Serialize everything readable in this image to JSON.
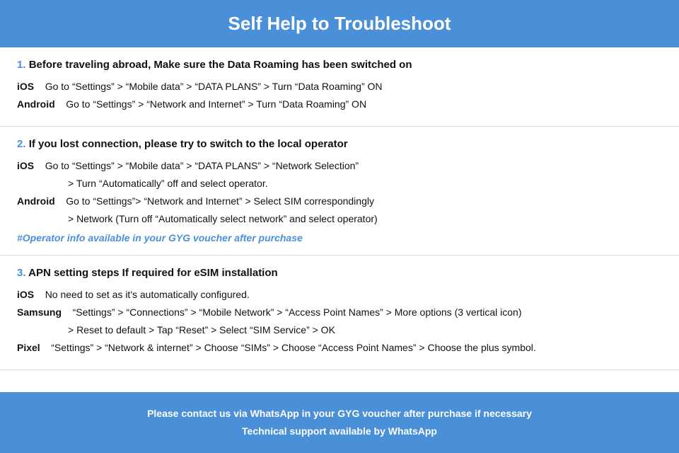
{
  "header": {
    "title": "Self Help to Troubleshoot"
  },
  "sections": [
    {
      "id": "section-1",
      "number": "1.",
      "title": "Before traveling abroad, Make sure the Data Roaming has been switched on",
      "items": [
        {
          "platform": "iOS",
          "text": "Go to “Settings” > “Mobile data” > “DATA PLANS” > Turn “Data Roaming” ON",
          "continuation": null
        },
        {
          "platform": "Android",
          "text": "Go to “Settings” > “Network and Internet” > Turn “Data Roaming” ON",
          "continuation": null
        }
      ],
      "link": null
    },
    {
      "id": "section-2",
      "number": "2.",
      "title": "If you lost connection, please try to switch to the local operator",
      "items": [
        {
          "platform": "iOS",
          "text": "Go to “Settings” > “Mobile data” > “DATA PLANS” > “Network Selection”",
          "continuation": "> Turn “Automatically” off and select operator."
        },
        {
          "platform": "Android",
          "text": "Go to “Settings”>  “Network and Internet” > Select SIM correspondingly",
          "continuation": "> Network (Turn off “Automatically select network” and select operator)"
        }
      ],
      "link": "#Operator info available in your GYG voucher after purchase"
    },
    {
      "id": "section-3",
      "number": "3.",
      "title": "APN setting steps If required for eSIM installation",
      "items": [
        {
          "platform": "iOS",
          "text": "No need to set as it's automatically configured.",
          "continuation": null
        },
        {
          "platform": "Samsung",
          "text": "“Settings” > “Connections” > “Mobile Network” > “Access Point Names” > More options (3 vertical icon)",
          "continuation": "> Reset to default > Tap “Reset” > Select “SIM Service” > OK"
        },
        {
          "platform": "Pixel",
          "text": "“Settings” > “Network & internet” > Choose “SIMs” > Choose “Access Point Names” > Choose the plus symbol.",
          "continuation": null
        }
      ],
      "link": null
    }
  ],
  "footer": {
    "line1": "Please contact us via WhatsApp  in your GYG voucher after purchase if necessary",
    "line2": "Technical support available by WhatsApp"
  }
}
